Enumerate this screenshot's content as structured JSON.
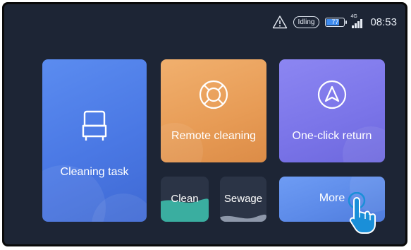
{
  "status_bar": {
    "warning_icon": "warning-triangle-icon",
    "state": "Idling",
    "battery_level": "77",
    "battery_fraction": 0.77,
    "network_type": "4G",
    "time": "08:53"
  },
  "tiles": {
    "cleaning_task": {
      "label": "Cleaning task",
      "icon": "robot-cleaner-icon"
    },
    "remote_cleaning": {
      "label": "Remote cleaning",
      "icon": "lifebuoy-icon"
    },
    "one_click_return": {
      "label": "One-click return",
      "icon": "navigation-arrow-icon"
    },
    "clean": {
      "label": "Clean",
      "water_level": 0.45,
      "color": "#3aaea0"
    },
    "sewage": {
      "label": "Sewage",
      "water_level": 0.1,
      "color": "#8e98aa"
    },
    "more": {
      "label": "More"
    }
  },
  "cursor": {
    "icon": "tap-hand-icon"
  },
  "colors": {
    "background": "#1d2535",
    "task_tile": "#4a78e4",
    "remote_tile": "#e79b55",
    "return_tile": "#7a74e8",
    "more_tile": "#5d8be9"
  }
}
